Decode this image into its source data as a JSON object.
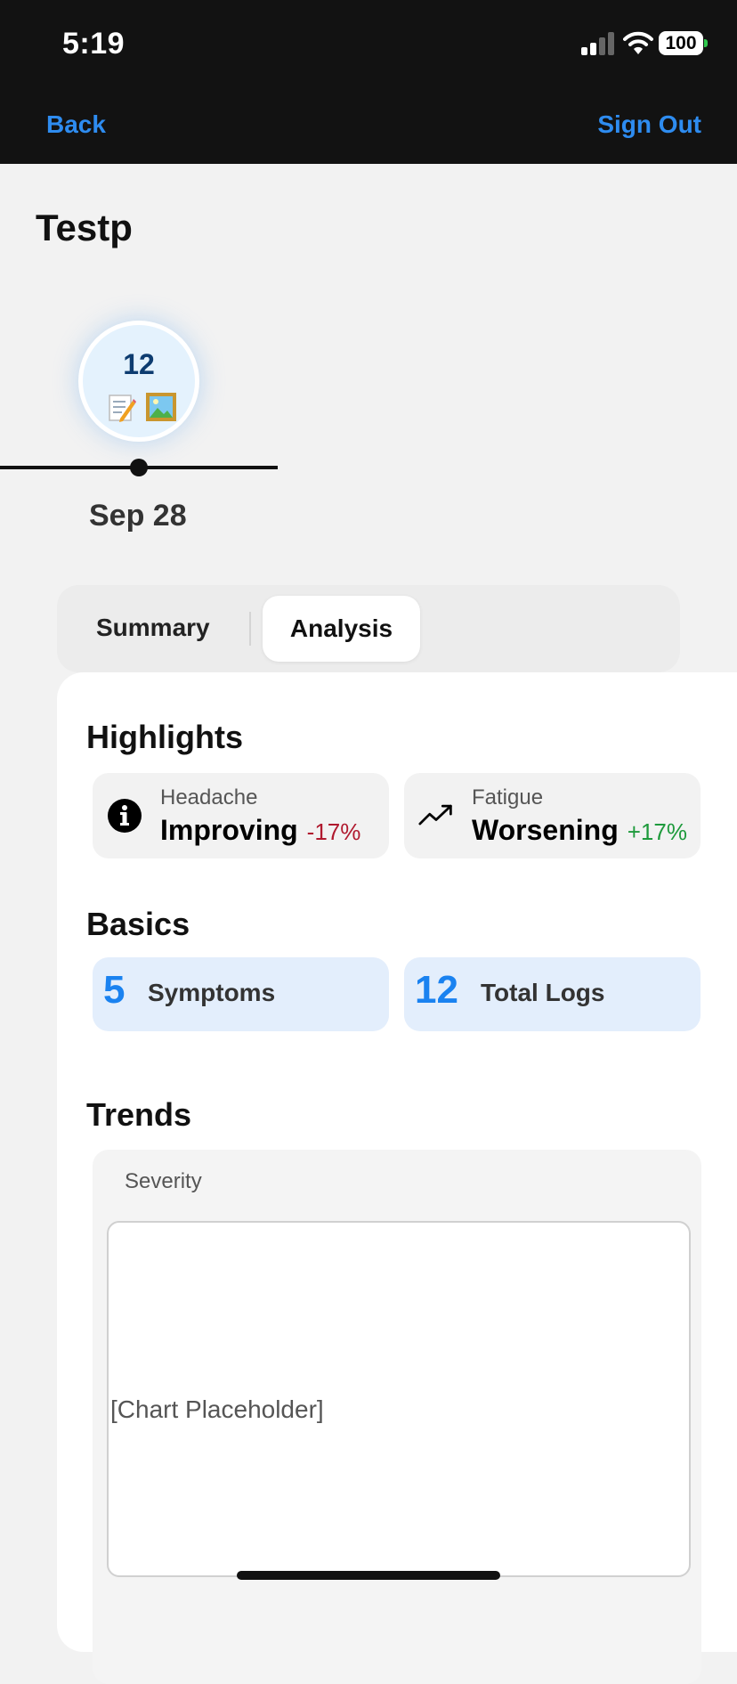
{
  "status_bar": {
    "time": "5:19",
    "battery": "100"
  },
  "nav": {
    "back_label": "Back",
    "signout_label": "Sign Out"
  },
  "page": {
    "title": "Testp"
  },
  "timeline": {
    "entries": [
      {
        "count": "12",
        "date": "Sep 28",
        "icons": [
          "memo-icon",
          "framed-picture-icon"
        ]
      }
    ]
  },
  "tabs": [
    {
      "label": "Summary",
      "selected": false
    },
    {
      "label": "Analysis",
      "selected": true
    }
  ],
  "highlights": {
    "title": "Highlights",
    "items": [
      {
        "name": "Headache",
        "status": "Improving",
        "change": "-17%",
        "change_color": "#b0192e",
        "icon": "info-icon"
      },
      {
        "name": "Fatigue",
        "status": "Worsening",
        "change": "+17%",
        "change_color": "#1e9a3c",
        "icon": "trend-up-icon"
      }
    ]
  },
  "basics": {
    "title": "Basics",
    "items": [
      {
        "value": "5",
        "label": "Symptoms"
      },
      {
        "value": "12",
        "label": "Total Logs"
      }
    ]
  },
  "trends": {
    "title": "Trends",
    "label": "Severity",
    "chart_placeholder": "[Chart Placeholder]"
  },
  "colors": {
    "accent": "#1a82f0",
    "nav_link": "#2e8cf0",
    "node_bg": "#e4f2fd"
  }
}
